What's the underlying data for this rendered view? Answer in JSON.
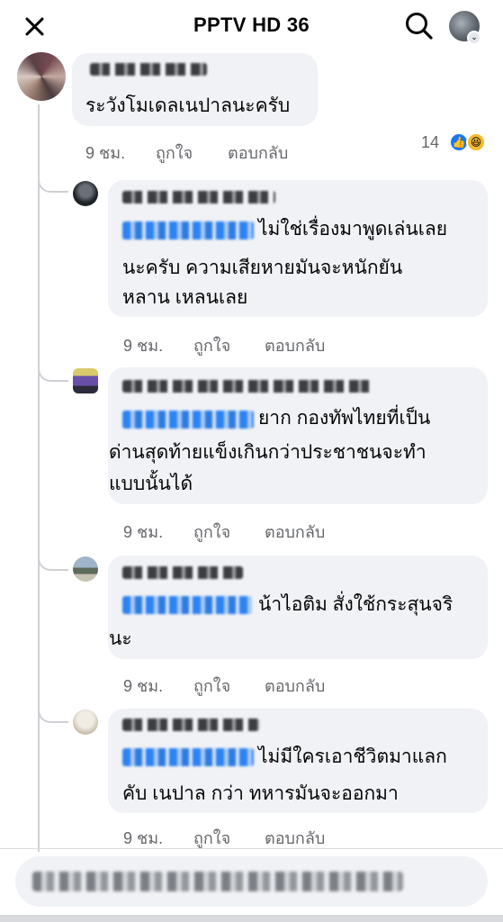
{
  "header": {
    "title": "PPTV HD 36"
  },
  "icons": {
    "close": "close-icon",
    "search": "search-icon",
    "profile": "profile-avatar",
    "chevron": "chevron-down-icon",
    "like": "like-reaction-icon",
    "haha": "haha-reaction-icon"
  },
  "comments": [
    {
      "text_lines": [
        "ระวังโมเดลเนปาลนะครับ"
      ],
      "time": "9 ชม.",
      "like_label": "ถูกใจ",
      "reply_label": "ตอบกลับ",
      "reaction_count": "14"
    },
    {
      "text_lines": [
        "ไม่ใช่เรื่องมาพูดเล่นเลย",
        "นะครับ ความเสียหายมันจะหนักยัน",
        "หลาน เหลนเลย"
      ],
      "time": "9 ชม.",
      "like_label": "ถูกใจ",
      "reply_label": "ตอบกลับ"
    },
    {
      "text_lines": [
        "ยาก กองทัพไทยที่เป็น",
        "ด่านสุดท้ายแข็งเกินกว่าประชาชนจะทำ",
        "แบบนั้นได้"
      ],
      "time": "9 ชม.",
      "like_label": "ถูกใจ",
      "reply_label": "ตอบกลับ"
    },
    {
      "text_lines": [
        "น้าไอติม สั่งใช้กระสุนจริ",
        "นะ"
      ],
      "time": "9 ชม.",
      "like_label": "ถูกใจ",
      "reply_label": "ตอบกลับ"
    },
    {
      "text_lines": [
        "ไม่มีใครเอาชีวิตมาแลก",
        "คับ เนปาล กว่า ทหารมันจะออกมา"
      ],
      "time": "9 ชม.",
      "like_label": "ถูกใจ",
      "reply_label": "ตอบกลับ"
    }
  ],
  "colors": {
    "bubble": "#f0f2f5",
    "meta_text": "#65676b",
    "mention": "#1877f2",
    "thread_line": "#ced0d4"
  }
}
